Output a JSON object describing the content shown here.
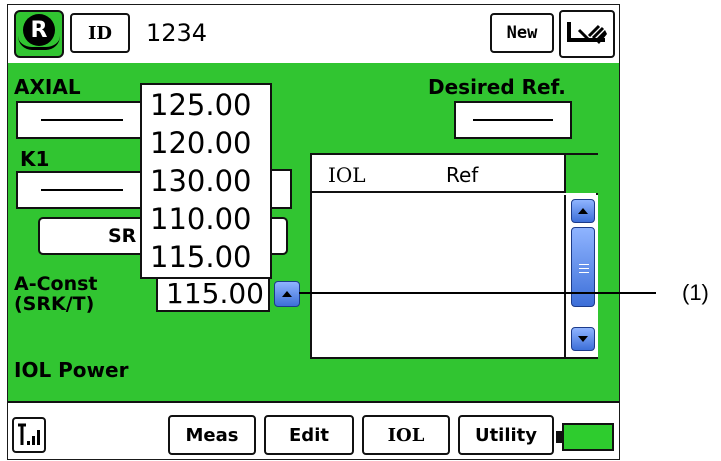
{
  "header": {
    "id_label": "ID",
    "id_value": "1234",
    "new_label": "New",
    "logo_letter": "R"
  },
  "left": {
    "axial_label": "AXIAL",
    "k1_label": "K1",
    "srk_button_label": "SR",
    "aconst_label_line1": "A-Const",
    "aconst_label_line2": "(SRK/T)",
    "aconst_value": "115.00",
    "iol_power_label": "IOL Power"
  },
  "right": {
    "desired_ref_label": "Desired Ref."
  },
  "dropdown": {
    "options": [
      "125.00",
      "120.00",
      "130.00",
      "110.00",
      "115.00"
    ]
  },
  "table": {
    "columns": [
      "IOL",
      "Ref"
    ]
  },
  "footer": {
    "tabs": [
      "Meas",
      "Edit",
      "IOL",
      "Utility"
    ]
  },
  "callout": {
    "label": "(1)"
  },
  "icons": {
    "logo": "r-logo-icon",
    "printer": "printer-icon",
    "signal": "signal-icon",
    "battery": "battery-icon",
    "scroll_up": "scroll-up-icon",
    "scroll_down": "scroll-down-icon",
    "spin_up": "spin-up-icon"
  },
  "colors": {
    "screen": "#31c531",
    "accent_blue": "#3d6fd8",
    "battery": "#2ecc2e"
  }
}
